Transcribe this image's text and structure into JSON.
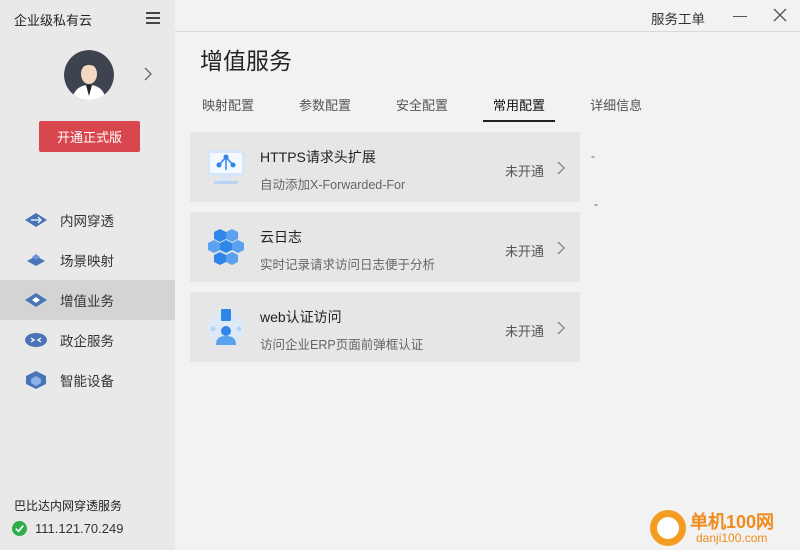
{
  "app": {
    "title": "企业级私有云",
    "upgrade_label": "开通正式版",
    "service_label": "巴比达内网穿透服务",
    "ip_address": "111.121.70.249"
  },
  "sidebar": {
    "items": [
      {
        "label": "内网穿透",
        "icon": "network-tunnel-icon",
        "active": false
      },
      {
        "label": "场景映射",
        "icon": "scene-mapping-icon",
        "active": false
      },
      {
        "label": "增值业务",
        "icon": "value-added-icon",
        "active": true
      },
      {
        "label": "政企服务",
        "icon": "enterprise-service-icon",
        "active": false
      },
      {
        "label": "智能设备",
        "icon": "smart-device-icon",
        "active": false
      }
    ]
  },
  "header": {
    "ticket_label": "服务工单"
  },
  "main": {
    "title": "增值服务",
    "tabs": [
      {
        "label": "映射配置",
        "active": false
      },
      {
        "label": "参数配置",
        "active": false
      },
      {
        "label": "安全配置",
        "active": false
      },
      {
        "label": "常用配置",
        "active": true
      },
      {
        "label": "详细信息",
        "active": false
      }
    ],
    "cards": [
      {
        "title": "HTTPS请求头扩展",
        "desc": "自动添加X-Forwarded-For",
        "status": "未开通",
        "icon": "https-header-icon"
      },
      {
        "title": "云日志",
        "desc": "实时记录请求访问日志便于分析",
        "status": "未开通",
        "icon": "cloud-log-icon"
      },
      {
        "title": "web认证访问",
        "desc": "访问企业ERP页面前弹框认证",
        "status": "未开通",
        "icon": "web-auth-icon"
      }
    ],
    "dash_1": "-",
    "dash_2": "-"
  },
  "watermark": {
    "text_main": "单机100网",
    "text_sub": "danji100.com"
  },
  "colors": {
    "accent_red": "#d8474d",
    "icon_blue": "#2f86e8",
    "status_green": "#2dae48",
    "watermark_orange": "#f08a1c"
  }
}
